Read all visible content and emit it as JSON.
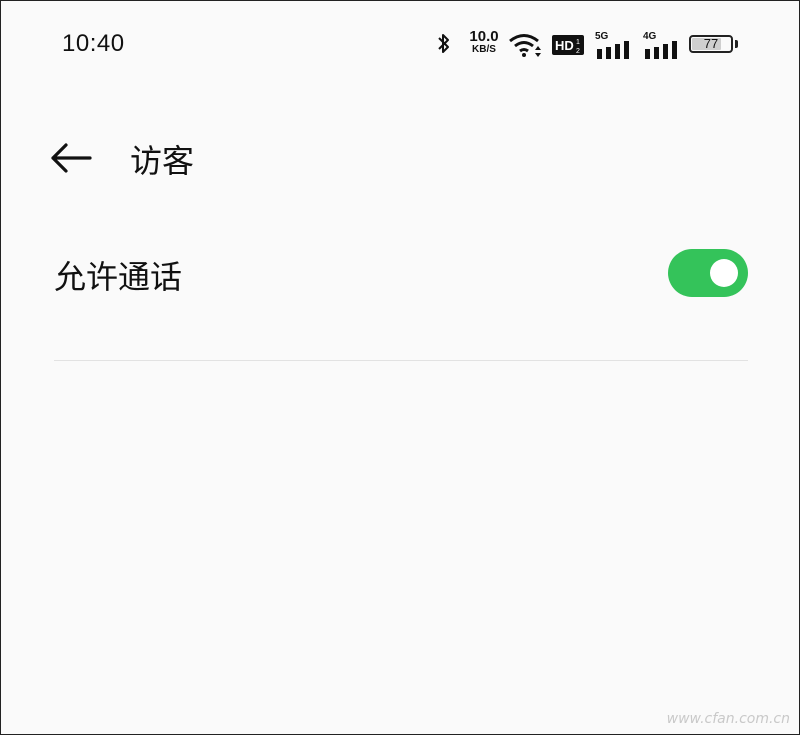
{
  "status_bar": {
    "time": "10:40",
    "net_speed_value": "10.0",
    "net_speed_unit": "KB/S",
    "hd_label": "HD",
    "sim1_label": "5G",
    "sim2_label": "4G",
    "battery_level": "77",
    "icons": [
      "bluetooth-icon",
      "wifi-icon",
      "hd-volte-icon",
      "signal-5g-icon",
      "signal-4g-icon",
      "battery-icon"
    ]
  },
  "header": {
    "title": "访客",
    "back_icon": "arrow-left-icon"
  },
  "settings": {
    "allow_calls_label": "允许通话",
    "allow_calls_enabled": true
  },
  "colors": {
    "toggle_on": "#34c35a",
    "background": "#fafafa"
  },
  "watermark": "www.cfan.com.cn"
}
